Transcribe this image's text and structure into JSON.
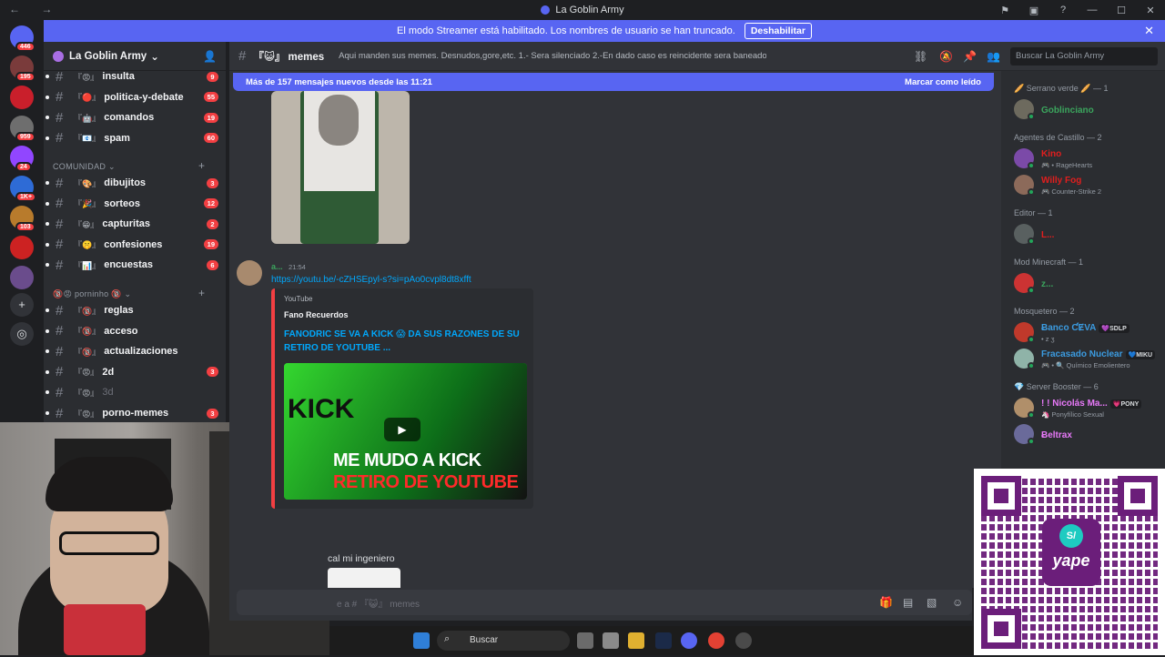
{
  "window": {
    "title": "La Goblin Army"
  },
  "banner": {
    "text": "El modo Streamer está habilitado. Los nombres de usuario se han truncado.",
    "button": "Deshabilitar"
  },
  "servers": [
    {
      "name": "discord-home",
      "badge": "446",
      "color": "#5865f2"
    },
    {
      "name": "server-2",
      "badge": "195",
      "color": "#7a3b3b"
    },
    {
      "name": "server-3",
      "badge": "",
      "color": "#c91f2b"
    },
    {
      "name": "server-4",
      "badge": "959",
      "color": "#6e6e6e"
    },
    {
      "name": "server-5",
      "badge": "24",
      "color": "#9146ff"
    },
    {
      "name": "server-6",
      "badge": "1K+",
      "color": "#2e6bd6"
    },
    {
      "name": "server-7",
      "badge": "103",
      "color": "#b87b2c"
    },
    {
      "name": "server-8",
      "badge": "",
      "color": "#cc2222"
    },
    {
      "name": "server-9",
      "badge": "",
      "color": "#6a4c8c"
    }
  ],
  "server": {
    "name": "La Goblin Army"
  },
  "channels_top": [
    {
      "emoji": "『😡』",
      "name": "insulta",
      "count": "9"
    },
    {
      "emoji": "『🔴』",
      "name": "politica-y-debate",
      "count": "55"
    },
    {
      "emoji": "『🤖』",
      "name": "comandos",
      "count": "19"
    },
    {
      "emoji": "『📧』",
      "name": "spam",
      "count": "60"
    }
  ],
  "categories": {
    "comunidad": "COMUNIDAD",
    "porninho": "porninho"
  },
  "channels_comunidad": [
    {
      "emoji": "『🎨』",
      "name": "dibujitos",
      "count": "3"
    },
    {
      "emoji": "『🎉』",
      "name": "sorteos",
      "count": "12"
    },
    {
      "emoji": "『😁』",
      "name": "capturitas",
      "count": "2"
    },
    {
      "emoji": "『🤫』",
      "name": "confesiones",
      "count": "19"
    },
    {
      "emoji": "『📊』",
      "name": "encuestas",
      "count": "6"
    }
  ],
  "channels_porn": [
    {
      "emoji": "『🔞』",
      "name": "reglas",
      "count": "",
      "muted": false
    },
    {
      "emoji": "『🔞』",
      "name": "acceso",
      "count": "",
      "muted": false
    },
    {
      "emoji": "『🔞』",
      "name": "actualizaciones",
      "count": "",
      "muted": false
    },
    {
      "emoji": "『😡』",
      "name": "2d",
      "count": "3",
      "muted": false
    },
    {
      "emoji": "『😡』",
      "name": "3d",
      "count": "",
      "muted": true
    },
    {
      "emoji": "『😡』",
      "name": "porno-memes",
      "count": "3",
      "muted": false
    }
  ],
  "header": {
    "channel": "『😺』 memes",
    "topic": "Aqui manden sus memes. Desnudos,gore,etc. 1.- Sera silenciado 2.-En dado caso es reincidente sera baneado",
    "search_placeholder": "Buscar La Goblin Army"
  },
  "new_messages": {
    "text": "Más de 157 mensajes nuevos desde las 11:21",
    "action": "Marcar como leído"
  },
  "message": {
    "author": "a...",
    "time": "21:54",
    "link": "https://youtu.be/-cZHSEpyl-s?si=pAo0cvpl8dt8xfft",
    "embed": {
      "provider": "YouTube",
      "author": "Fano Recuerdos",
      "title": "FANODRIC SE VA A KICK 😱 DA SUS RAZONES DE SU RETIRO DE YOUTUBE ...",
      "thumb_kick": "KICK",
      "thumb_line1": "ME MUDO A KICK",
      "thumb_line2": "RETIRO DE YOUTUBE"
    }
  },
  "message2": {
    "text": "cal mi ingeniero"
  },
  "composer": {
    "placeholder": "e a # 『😺』 memes"
  },
  "members": [
    {
      "category": "🥖 Serrano verde 🥖 — 1",
      "items": [
        {
          "name": "Goblinciano",
          "color": "#3ba55d",
          "sub": ""
        }
      ]
    },
    {
      "category": "Agentes de Castillo — 2",
      "items": [
        {
          "name": "Kino",
          "color": "#e01e1e",
          "sub": "🎮 • RageHearts"
        },
        {
          "name": "Willy Fog",
          "color": "#e01e1e",
          "sub": "🎮 Counter-Strike 2"
        }
      ]
    },
    {
      "category": "Editor — 1",
      "items": [
        {
          "name": "L...",
          "color": "#e01e1e",
          "sub": ""
        }
      ]
    },
    {
      "category": "Mod Minecraft — 1",
      "items": [
        {
          "name": "z...",
          "color": "#3ba55d",
          "sub": ""
        }
      ]
    },
    {
      "category": "Mosquetero — 2",
      "items": [
        {
          "name": "Ƀanco ƇɆVA",
          "color": "#3b9be0",
          "sub": "• z ʒ",
          "tag": "💜SDLP"
        },
        {
          "name": "Fracasado Nuclear",
          "color": "#3b9be0",
          "sub": "🎮 • 🔍 Químico Emolientero",
          "tag": "💙MIKU"
        }
      ]
    },
    {
      "category": "💎 Server Booster — 6",
      "items": [
        {
          "name": "! ! Nicolás Ma...",
          "color": "#e879f9",
          "sub": "🦄 Ponyfílico Sexual",
          "tag": "💗PONY"
        },
        {
          "name": "Ƀeltrax",
          "color": "#e879f9",
          "sub": ""
        }
      ]
    }
  ],
  "qr": {
    "brand": "yape",
    "symbol": "S/"
  },
  "taskbar": {
    "search": "Buscar"
  }
}
